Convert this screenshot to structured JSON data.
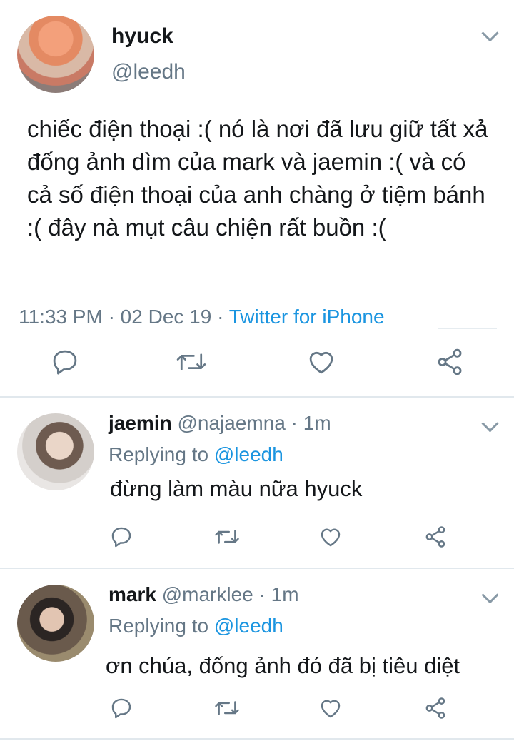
{
  "main": {
    "name": "hyuck",
    "handle": "@leedh",
    "text": "chiếc điện thoại :( nó là nơi đã lưu giữ tất xả đống ảnh dìm của mark và jaemin :( và có cả số điện thoại của anh chàng ở tiệm bánh :( đây nà mụt câu chiện rất buồn :(",
    "time": "11:33 PM",
    "date": "02 Dec 19",
    "source": "Twitter for iPhone",
    "sep": "·"
  },
  "replies": [
    {
      "name": "jaemin",
      "handle": "@najaemna",
      "age": "1m",
      "replying_label": "Replying to",
      "mention": "@leedh",
      "text": "đừng làm màu nữa hyuck"
    },
    {
      "name": "mark",
      "handle": "@marklee",
      "age": "1m",
      "replying_label": "Replying to",
      "mention": "@leedh",
      "text": "ơn chúa, đống ảnh đó đã bị tiêu diệt"
    }
  ],
  "icons": {
    "reply": "reply-icon",
    "retweet": "retweet-icon",
    "like": "heart-icon",
    "share": "share-icon",
    "menu": "chevron-down-icon"
  },
  "colors": {
    "text": "#14171a",
    "muted": "#657786",
    "link": "#1b95e0",
    "icon": "#657786",
    "divider": "#e1e8ed"
  }
}
